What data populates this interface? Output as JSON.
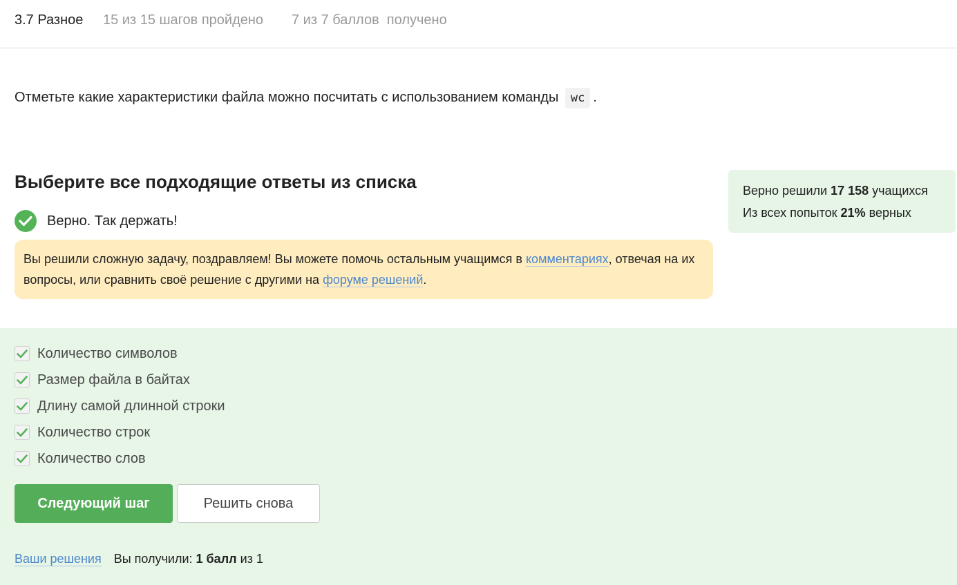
{
  "header": {
    "title": "3.7 Разное",
    "steps_progress": "15 из 15 шагов пройдено",
    "score_progress": "7 из 7 баллов  получено"
  },
  "question": {
    "text": "Отметьте какие характеристики файла можно посчитать с использованием команды",
    "code": "wc",
    "suffix": "."
  },
  "answer_heading": "Выберите все подходящие ответы из списка",
  "result": {
    "text": "Верно. Так держать!",
    "icon": "check-circle-icon",
    "color": "#54b357"
  },
  "hint": {
    "part1": "Вы решили сложную задачу, поздравляем! Вы можете помочь остальным учащимся в ",
    "link1": "комментариях",
    "part2": ", отвечая на их вопросы, или сравнить своё решение с другими на ",
    "link2": "форуме решений",
    "part3": "."
  },
  "stats": {
    "solved_prefix": "Верно решили ",
    "solved_count": "17 158",
    "solved_suffix": " учащихся",
    "attempts_prefix": "Из всех попыток ",
    "attempts_percent": "21%",
    "attempts_suffix": " верных"
  },
  "options": [
    {
      "label": "Количество символов",
      "checked": true
    },
    {
      "label": "Размер файла в байтах",
      "checked": true
    },
    {
      "label": "Длину самой длинной строки",
      "checked": true
    },
    {
      "label": "Количество строк",
      "checked": true
    },
    {
      "label": "Количество слов",
      "checked": true
    }
  ],
  "buttons": {
    "next": "Следующий шаг",
    "retry": "Решить снова"
  },
  "footer": {
    "solutions_link": "Ваши решения",
    "received_prefix": "Вы получили: ",
    "received_points": "1 балл",
    "received_suffix": " из 1"
  },
  "colors": {
    "accent_green": "#54ad58",
    "answers_bg": "#e7f6e7",
    "hint_bg": "#ffedbf",
    "link": "#4d87cd"
  }
}
